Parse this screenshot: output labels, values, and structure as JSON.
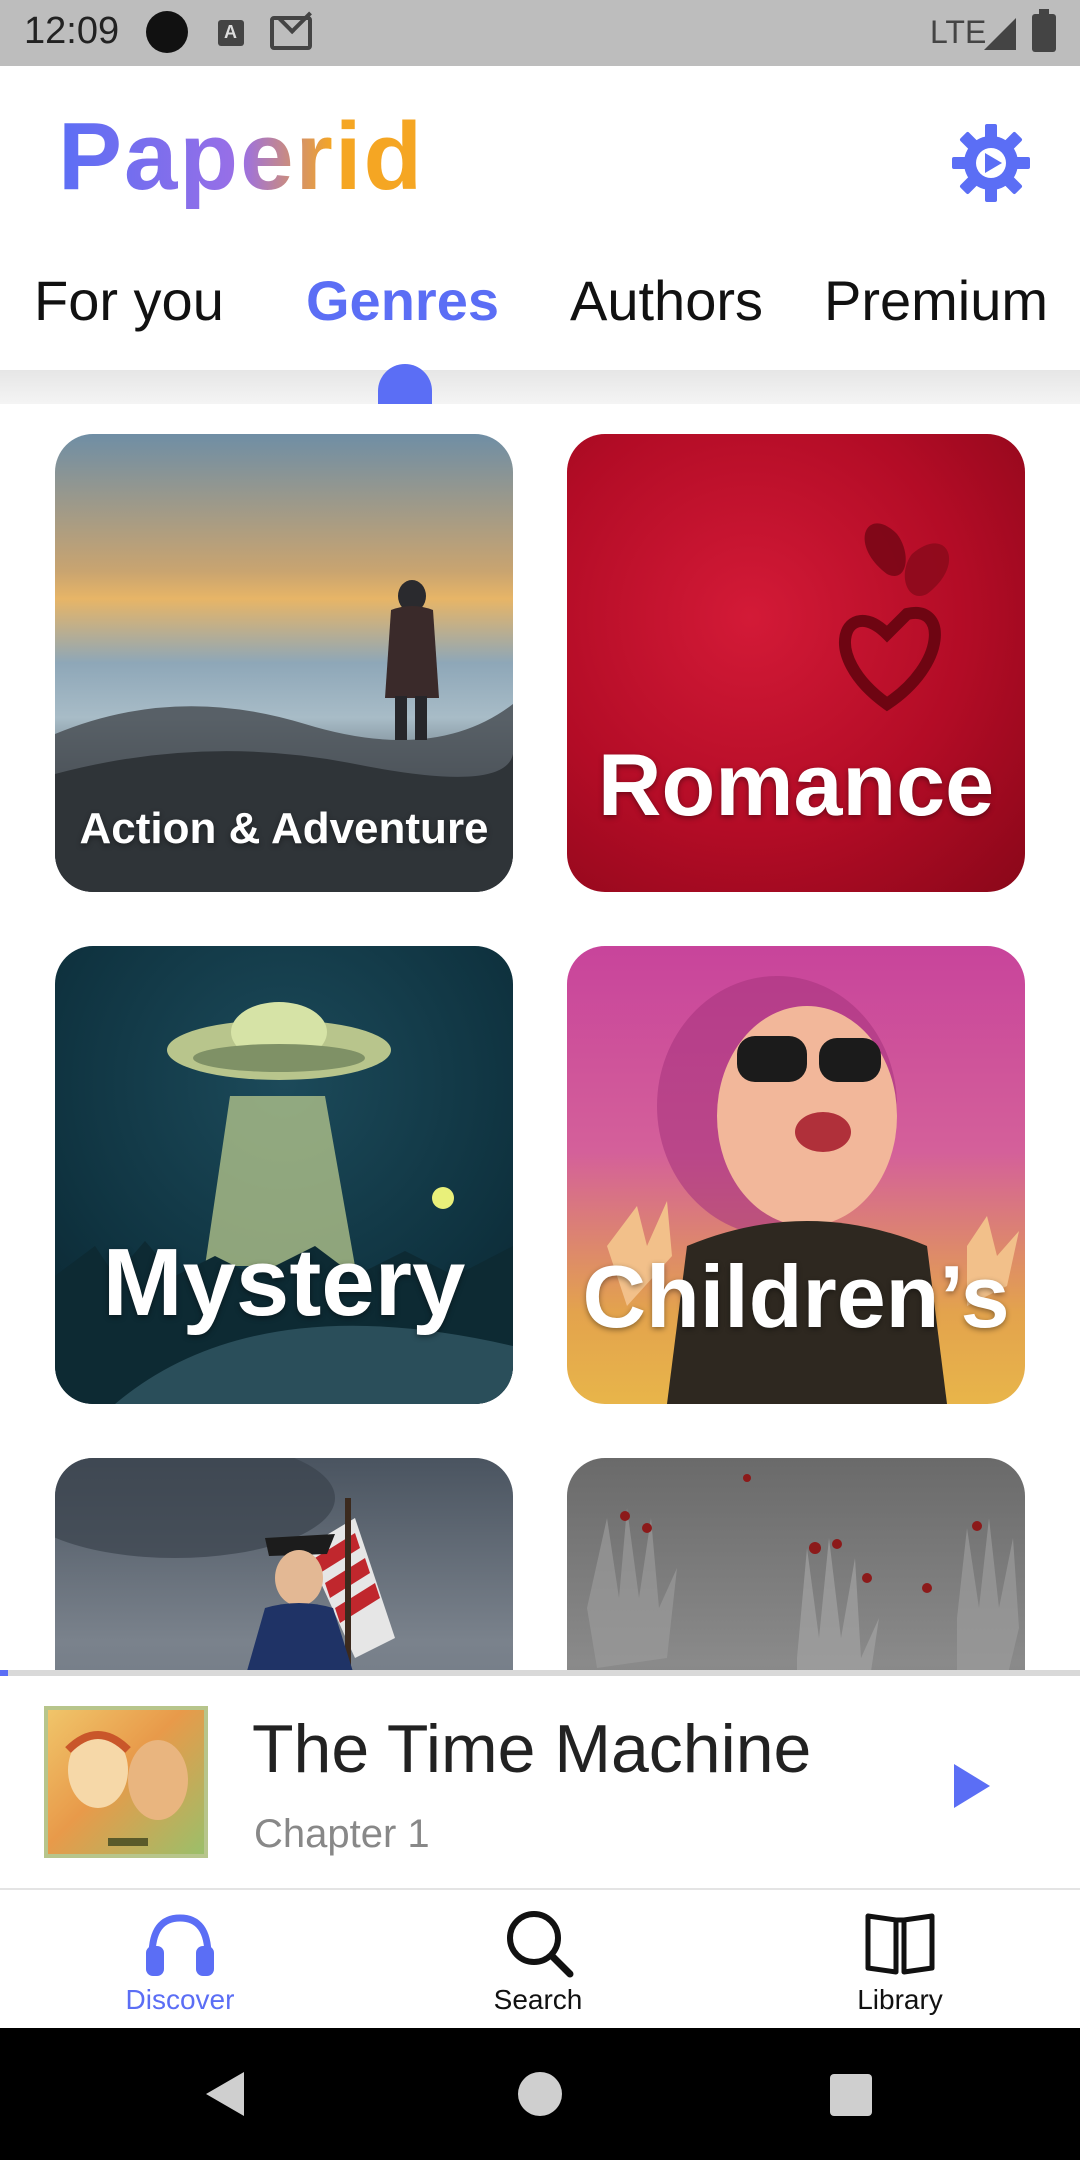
{
  "status_bar": {
    "time": "12:09",
    "network": "LTE",
    "a_badge": "A"
  },
  "header": {
    "logo": "Paperid",
    "settings_icon": "gear-icon"
  },
  "tabs": [
    {
      "label": "For you",
      "active": false
    },
    {
      "label": "Genres",
      "active": true
    },
    {
      "label": "Authors",
      "active": false
    },
    {
      "label": "Premium",
      "active": false
    }
  ],
  "genres": [
    {
      "label": "Action & Adventure"
    },
    {
      "label": "Romance"
    },
    {
      "label": "Mystery"
    },
    {
      "label": "Children’s"
    },
    {
      "label": ""
    },
    {
      "label": ""
    }
  ],
  "mini_player": {
    "title": "The Time Machine",
    "subtitle": "Chapter 1",
    "play_icon": "play-icon"
  },
  "bottom_nav": [
    {
      "label": "Discover",
      "icon": "headphones-icon",
      "active": true
    },
    {
      "label": "Search",
      "icon": "search-icon",
      "active": false
    },
    {
      "label": "Library",
      "icon": "book-icon",
      "active": false
    }
  ],
  "colors": {
    "accent": "#5b6ef5",
    "logo_purple": "#9a6fe6",
    "logo_orange": "#f5a623"
  }
}
